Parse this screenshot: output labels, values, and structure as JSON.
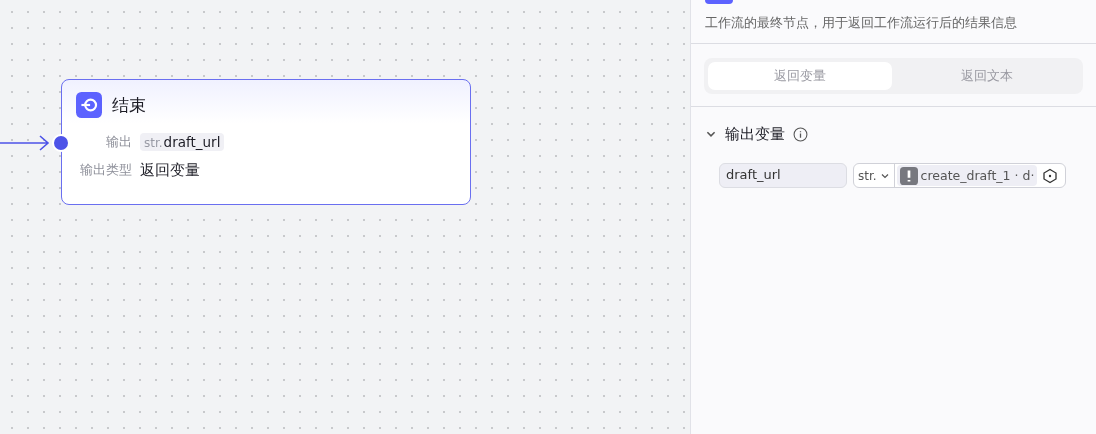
{
  "canvas": {
    "node": {
      "title": "结束",
      "rows": [
        {
          "kind": "tag",
          "label": "输出",
          "type": "str.",
          "value": "draft_url"
        },
        {
          "kind": "text",
          "label": "输出类型",
          "value": "返回变量"
        }
      ]
    }
  },
  "panel": {
    "description": "工作流的最终节点，用于返回工作流运行后的结果信息",
    "mode_switch": {
      "disabled": true,
      "tabs": [
        {
          "label": "返回变量",
          "selected": true
        },
        {
          "label": "返回文本",
          "selected": false
        }
      ]
    },
    "section": {
      "title": "输出变量",
      "expanded": true,
      "variables": [
        {
          "name": "draft_url",
          "type": "str.",
          "source": "create_draft_1 · d·"
        }
      ]
    }
  }
}
